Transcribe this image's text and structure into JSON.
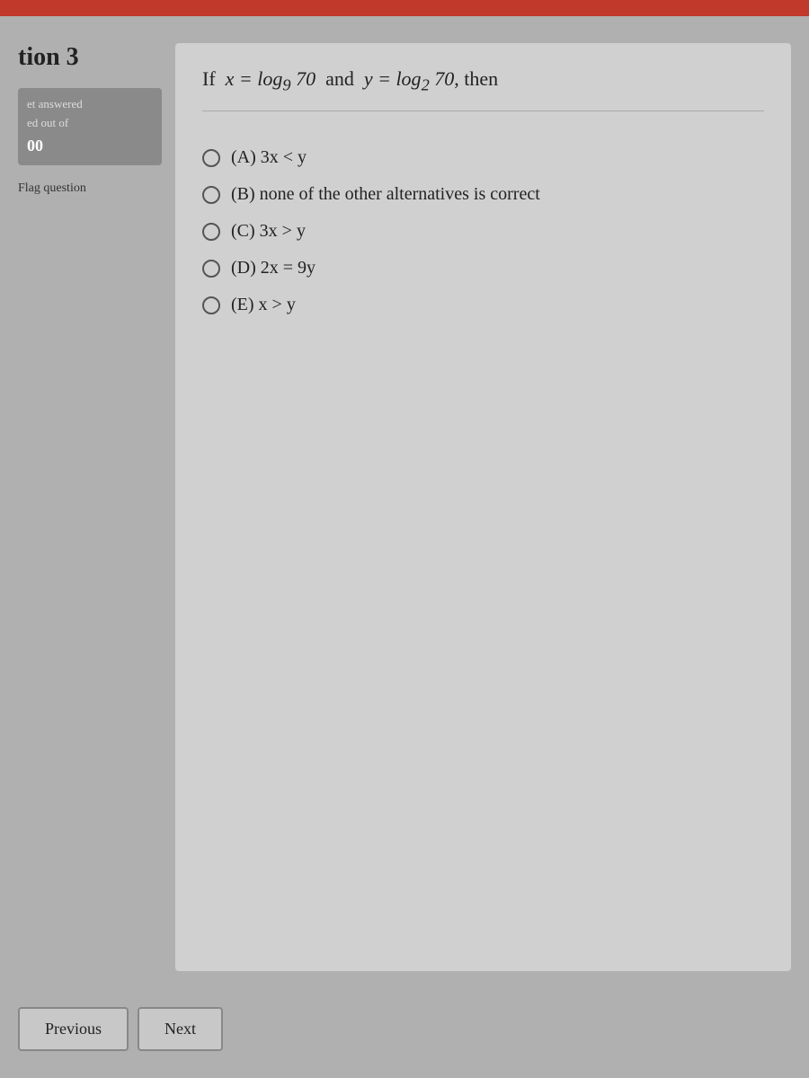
{
  "redbar": {
    "color": "#c0392b"
  },
  "sidebar": {
    "question_number": "tion 3",
    "not_answered_label": "et answered",
    "graded_label": "ed out of",
    "score": "00",
    "flag_label": "Flag question"
  },
  "question": {
    "text_html": "If x = log<sub>9</sub> 70 and y = log<sub>2</sub> 70, then",
    "options": [
      {
        "id": "A",
        "label": "(A) 3x < y"
      },
      {
        "id": "B",
        "label": "(B) none of the other alternatives is correct"
      },
      {
        "id": "C",
        "label": "(C) 3x > y"
      },
      {
        "id": "D",
        "label": "(D) 2x = 9y"
      },
      {
        "id": "E",
        "label": "(E) x > y"
      }
    ]
  },
  "navigation": {
    "previous_label": "Previous",
    "next_label": "Next"
  }
}
